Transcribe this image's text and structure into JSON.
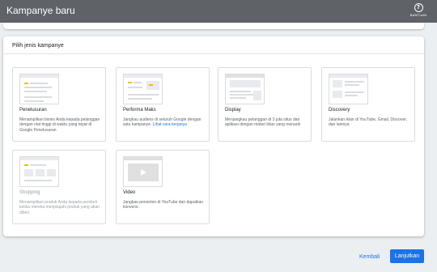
{
  "header": {
    "title": "Kampanye baru",
    "help_label": "BANTUAN",
    "help_glyph": "?"
  },
  "panel": {
    "title": "Pilih jenis kampanye"
  },
  "cards": [
    {
      "title": "Penelusuran",
      "desc": "Menampilkan bisnis Anda kepada pelanggan dengan niat tinggi di waktu yang tepat di Google Penelusuran"
    },
    {
      "title": "Performa Maks",
      "desc": "Jangkau audiens di seluruh Google dengan satu kampanye.",
      "link": "Lihat cara kerjanya"
    },
    {
      "title": "Display",
      "desc": "Menjangkau pelanggan di 3 juta situs dan aplikasi dengan materi iklan yang menarik"
    },
    {
      "title": "Discovery",
      "desc": "Jalankan iklan di YouTube, Gmail, Discover, dan lainnya"
    },
    {
      "title": "Shopping",
      "desc": "Menampilkan produk Anda kepada pembeli ketika mereka menjelajahi produk yang akan dibeli"
    },
    {
      "title": "Video",
      "desc": "Jangkau penonton di YouTube dan dapatkan konversi"
    }
  ],
  "footer": {
    "back_label": "Kembali",
    "next_label": "Lanjutkan"
  },
  "colors": {
    "accent": "#1a73e8",
    "topbar": "#5f6368",
    "highlight": "#fbbc04"
  }
}
